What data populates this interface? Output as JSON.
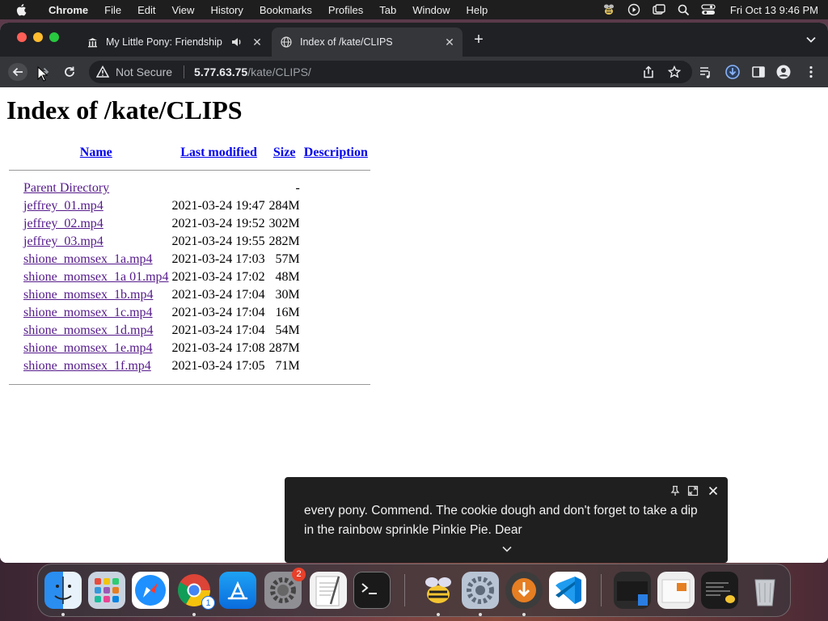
{
  "menubar": {
    "app_name": "Chrome",
    "items": [
      "File",
      "Edit",
      "View",
      "History",
      "Bookmarks",
      "Profiles",
      "Tab",
      "Window",
      "Help"
    ],
    "clock": "Fri Oct 13  9:46 PM"
  },
  "tabs": [
    {
      "title": "My Little Pony: Friendship",
      "favicon": "museum-icon",
      "audio": true,
      "active": false
    },
    {
      "title": "Index of /kate/CLIPS",
      "favicon": "globe-icon",
      "active": true
    }
  ],
  "omnibox": {
    "security_label": "Not Secure",
    "host": "5.77.63.75",
    "path": "/kate/CLIPS/"
  },
  "page": {
    "heading": "Index of /kate/CLIPS",
    "columns": {
      "name": "Name",
      "modified": "Last modified",
      "size": "Size",
      "description": "Description"
    },
    "parent": {
      "name": "Parent Directory",
      "modified": "",
      "size": "-"
    },
    "files": [
      {
        "name": "jeffrey_01.mp4",
        "modified": "2021-03-24 19:47",
        "size": "284M"
      },
      {
        "name": "jeffrey_02.mp4",
        "modified": "2021-03-24 19:52",
        "size": "302M"
      },
      {
        "name": "jeffrey_03.mp4",
        "modified": "2021-03-24 19:55",
        "size": "282M"
      },
      {
        "name": "shione_momsex_1a.mp4",
        "modified": "2021-03-24 17:03",
        "size": "57M"
      },
      {
        "name": "shione_momsex_1a 01.mp4",
        "modified": "2021-03-24 17:02",
        "size": "48M"
      },
      {
        "name": "shione_momsex_1b.mp4",
        "modified": "2021-03-24 17:04",
        "size": "30M"
      },
      {
        "name": "shione_momsex_1c.mp4",
        "modified": "2021-03-24 17:04",
        "size": "16M"
      },
      {
        "name": "shione_momsex_1d.mp4",
        "modified": "2021-03-24 17:04",
        "size": "54M"
      },
      {
        "name": "shione_momsex_1e.mp4",
        "modified": "2021-03-24 17:08",
        "size": "287M"
      },
      {
        "name": "shione_momsex_1f.mp4",
        "modified": "2021-03-24 17:05",
        "size": "71M"
      }
    ]
  },
  "caption": {
    "text": "every pony. Commend. The cookie dough and don't forget to take a dip in the rainbow sprinkle Pinkie Pie. Dear"
  },
  "dock": {
    "settings_badge": "2",
    "chrome_badge": "1"
  },
  "colors": {
    "link": "#0000ee",
    "visited": "#551a8b",
    "chrome_dark": "#202124",
    "toolbar": "#35363a",
    "download_accent": "#8ab4f8"
  }
}
